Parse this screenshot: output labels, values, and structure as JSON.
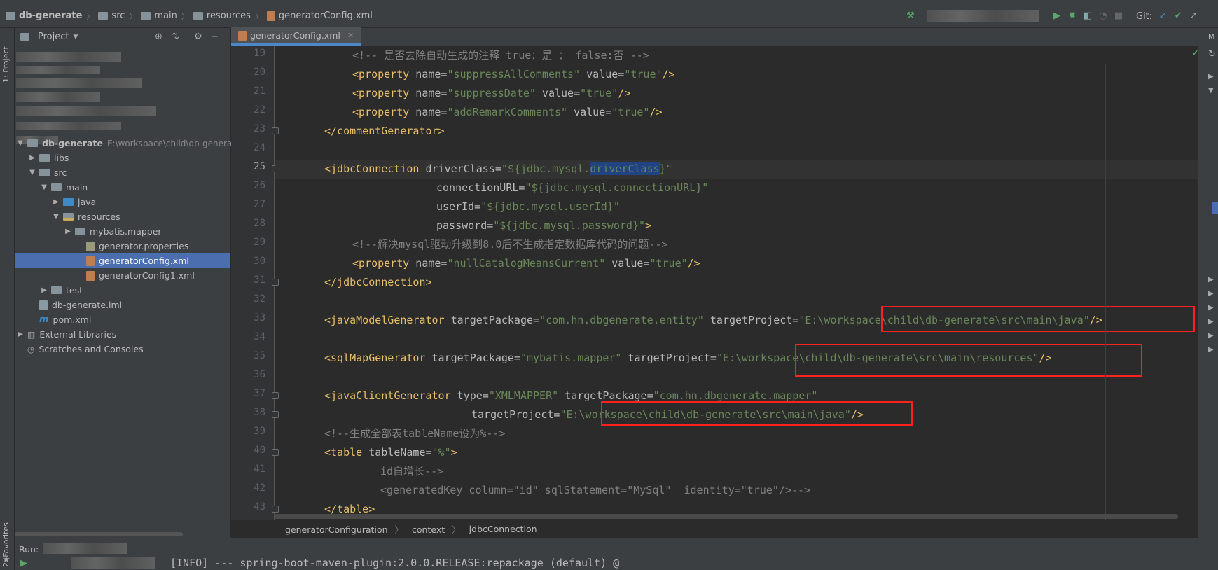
{
  "navbar": {
    "crumbs": [
      "db-generate",
      "src",
      "main",
      "resources",
      "generatorConfig.xml"
    ],
    "git_label": "Git:"
  },
  "left_strip": {
    "project_tab": "1: Project",
    "favorites_tab": "2: Favorites"
  },
  "project_panel": {
    "title": "Project",
    "tree": [
      {
        "label": "db-generate",
        "suffix": "E:\\workspace\\child\\db-generate",
        "arrow": "▼",
        "kind": "module",
        "bold": true
      },
      {
        "label": "libs",
        "arrow": "▶",
        "kind": "folder"
      },
      {
        "label": "src",
        "arrow": "▼",
        "kind": "folder"
      },
      {
        "label": "main",
        "arrow": "▼",
        "kind": "folder"
      },
      {
        "label": "java",
        "arrow": "▶",
        "kind": "folder-blue"
      },
      {
        "label": "resources",
        "arrow": "▼",
        "kind": "folder-res"
      },
      {
        "label": "mybatis.mapper",
        "arrow": "▶",
        "kind": "folder"
      },
      {
        "label": "generator.properties",
        "arrow": "",
        "kind": "props"
      },
      {
        "label": "generatorConfig.xml",
        "arrow": "",
        "kind": "xml",
        "selected": true
      },
      {
        "label": "generatorConfig1.xml",
        "arrow": "",
        "kind": "xml"
      },
      {
        "label": "test",
        "arrow": "▶",
        "kind": "folder"
      },
      {
        "label": "db-generate.iml",
        "arrow": "",
        "kind": "iml"
      },
      {
        "label": "pom.xml",
        "arrow": "",
        "kind": "pom"
      },
      {
        "label": "External Libraries",
        "arrow": "▶",
        "kind": "lib"
      },
      {
        "label": "Scratches and Consoles",
        "arrow": "",
        "kind": "scratch"
      }
    ]
  },
  "editor": {
    "tab_label": "generatorConfig.xml",
    "line_numbers": [
      "19",
      "20",
      "21",
      "22",
      "23",
      "24",
      "25",
      "26",
      "27",
      "28",
      "29",
      "30",
      "31",
      "32",
      "33",
      "34",
      "35",
      "36",
      "37",
      "38",
      "39",
      "40",
      "41",
      "42",
      "43"
    ],
    "lines": {
      "l19": "<!-- 是否去除自动生成的注释 true：是 ： false:否 -->",
      "l20_tag": "<property",
      "l20_a1": " name=",
      "l20_v1": "\"suppressAllComments\"",
      "l20_a2": " value=",
      "l20_v2": "\"true\"",
      "l20_end": "/>",
      "l21_tag": "<property",
      "l21_a1": " name=",
      "l21_v1": "\"suppressDate\"",
      "l21_a2": " value=",
      "l21_v2": "\"true\"",
      "l21_end": "/>",
      "l22_tag": "<property",
      "l22_a1": " name=",
      "l22_v1": "\"addRemarkComments\"",
      "l22_a2": " value=",
      "l22_v2": "\"true\"",
      "l22_end": "/>",
      "l23": "</commentGenerator>",
      "l25_tag": "<jdbcConnection",
      "l25_a1": " driverClass=",
      "l25_v1a": "\"${jdbc.mysql.",
      "l25_v1b": "driverClass",
      "l25_v1c": "}\"",
      "l26_a": "connectionURL=",
      "l26_v": "\"${jdbc.mysql.connectionURL}\"",
      "l27_a": "userId=",
      "l27_v": "\"${jdbc.mysql.userId}\"",
      "l28_a": "password=",
      "l28_v": "\"${jdbc.mysql.password}\"",
      "l28_end": ">",
      "l29": "<!--解决mysql驱动升级到8.0后不生成指定数据库代码的问题-->",
      "l30_tag": "<property",
      "l30_a1": " name=",
      "l30_v1": "\"nullCatalogMeansCurrent\"",
      "l30_a2": " value=",
      "l30_v2": "\"true\"",
      "l30_end": "/>",
      "l31": "</jdbcConnection>",
      "l33_tag": "<javaModelGenerator",
      "l33_a1": " targetPackage=",
      "l33_v1": "\"com.hn.dbgenerate.entity\"",
      "l33_a2": " targetProject=",
      "l33_q": "\"",
      "l33_path": "E:\\workspace\\child\\db-generate\\src\\main\\java",
      "l33_q2": "\"",
      "l33_end": "/>",
      "l35_tag": "<sqlMapGenerator",
      "l35_a1": " targetPackage=",
      "l35_v1": "\"mybatis.mapper\"",
      "l35_a2": " targetProject=",
      "l35_q": "\"",
      "l35_path": "E:\\workspace\\child\\db-generate\\src\\main\\resources",
      "l35_q2": "\"",
      "l35_end": "/>",
      "l37_tag": "<javaClientGenerator",
      "l37_a1": " type=",
      "l37_v1": "\"XMLMAPPER\"",
      "l37_a2": " targetPackage=",
      "l37_v2": "\"com.hn.dbgenerate.mapper\"",
      "l38_a": "targetProject=",
      "l38_q": "\"",
      "l38_path": "E:\\workspace\\child\\db-generate\\src\\main\\java",
      "l38_q2": "\"",
      "l38_end": "/>",
      "l39": "<!--生成全部表tableName设为%-->",
      "l40_tag": "<table",
      "l40_a1": " tableName=",
      "l40_v1": "\"%\"",
      "l40_end": ">",
      "l41": "id自增长-->",
      "l42": "<generatedKey column=\"id\" sqlStatement=\"MySql\"  identity=\"true\"/>-->",
      "l43": "</table>"
    }
  },
  "breadcrumb_bar": [
    "generatorConfiguration",
    "context",
    "jdbcConnection"
  ],
  "run_bar": {
    "label": "Run:",
    "log_line": "[INFO] --- spring-boot-maven-plugin:2.0.0.RELEASE:repackage (default) @ "
  },
  "colors": {
    "background": "#2b2b2b",
    "panel": "#3c3f41",
    "tag": "#e8bf6a",
    "string": "#6a8759",
    "comment": "#808080",
    "selection": "#4b6eaf",
    "annotation_box": "#ff2020"
  }
}
